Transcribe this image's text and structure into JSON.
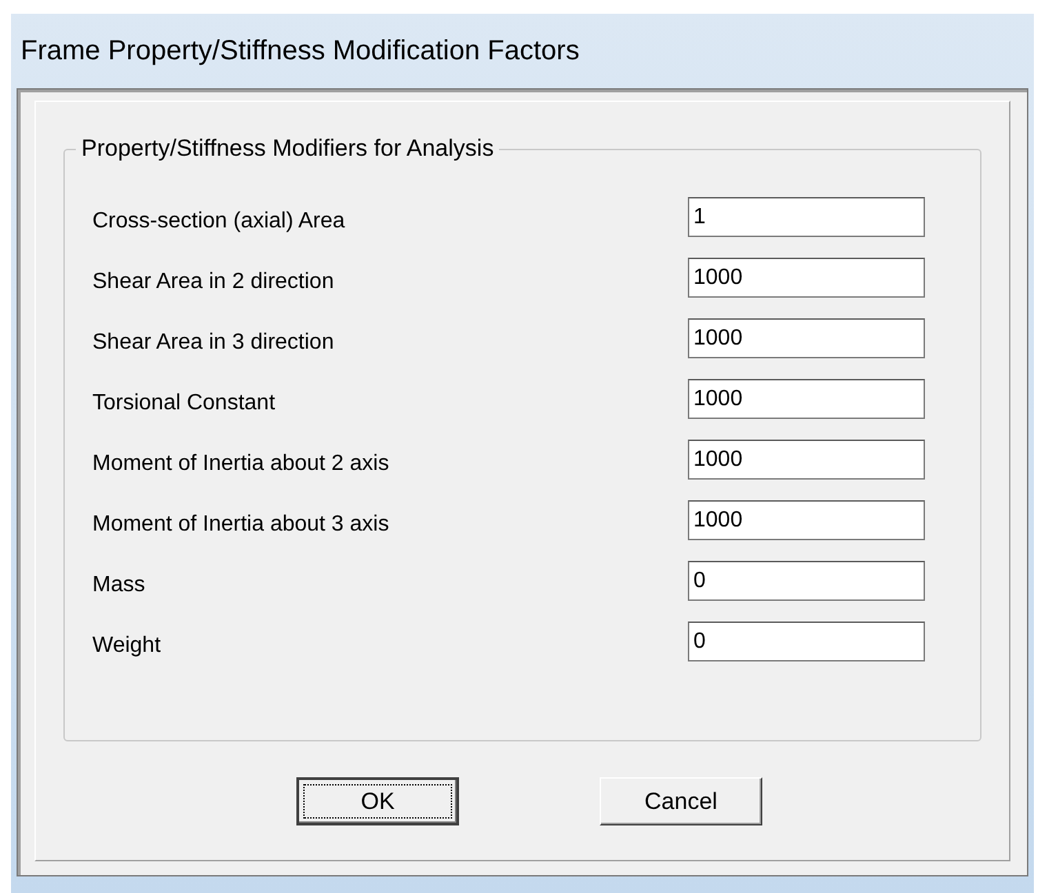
{
  "window": {
    "title": "Frame Property/Stiffness Modification Factors"
  },
  "group": {
    "title": "Property/Stiffness Modifiers for Analysis",
    "fields": [
      {
        "label": "Cross-section (axial) Area",
        "value": "1"
      },
      {
        "label": "Shear Area in 2 direction",
        "value": "1000"
      },
      {
        "label": "Shear Area in 3 direction",
        "value": "1000"
      },
      {
        "label": "Torsional Constant",
        "value": "1000"
      },
      {
        "label": "Moment of Inertia about 2 axis",
        "value": "1000"
      },
      {
        "label": "Moment of Inertia about 3 axis",
        "value": "1000"
      },
      {
        "label": "Mass",
        "value": "0"
      },
      {
        "label": "Weight",
        "value": "0"
      }
    ]
  },
  "buttons": [
    {
      "label": "OK",
      "focused": true
    },
    {
      "label": "Cancel",
      "focused": false
    }
  ]
}
